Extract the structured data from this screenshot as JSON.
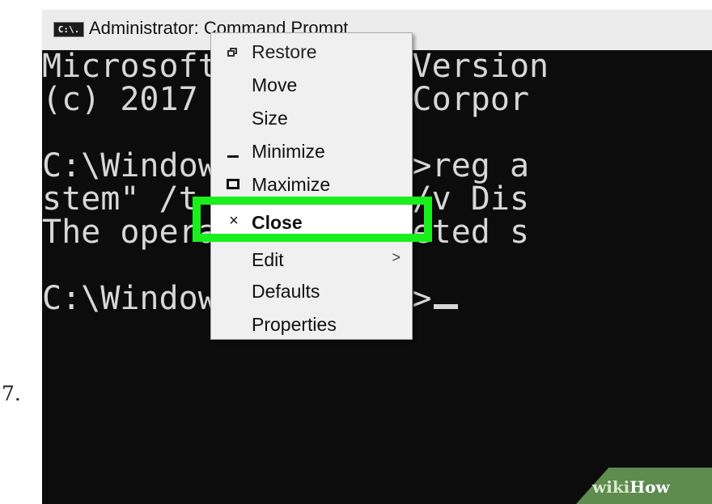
{
  "step_number": "7.",
  "window": {
    "title": "Administrator: Command Prompt",
    "icon_text": "C:\\."
  },
  "console": {
    "lines": [
      "Microsoft Windows [Version",
      "(c) 2017 Microsoft Corpor",
      "",
      "C:\\Windows\\system32>reg a",
      "stem\" /t REG_DWORD /v Dis",
      "The operation completed s",
      "",
      "C:\\Windows\\system32>"
    ]
  },
  "menu": {
    "items": [
      {
        "label": "Restore",
        "icon": "restore-icon"
      },
      {
        "label": "Move"
      },
      {
        "label": "Size"
      },
      {
        "label": "Minimize",
        "icon": "minimize-icon"
      },
      {
        "label": "Maximize",
        "icon": "maximize-icon"
      },
      {
        "label": "Close",
        "icon": "close-icon",
        "glyph": "×"
      },
      {
        "label": "Edit",
        "submenu_arrow": ">"
      },
      {
        "label": "Defaults"
      },
      {
        "label": "Properties"
      }
    ]
  },
  "highlight_color": "#19ef1c",
  "watermark": {
    "wiki": "wiki",
    "how": "How"
  }
}
